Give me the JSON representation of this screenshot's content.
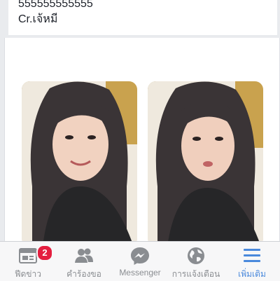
{
  "post": {
    "line1": "555555555555",
    "line2": "Cr.เจ้หมี"
  },
  "photos": [
    {
      "alt": "selfie smiling"
    },
    {
      "alt": "selfie pouting"
    }
  ],
  "tabbar": {
    "active_color": "#4a89dc",
    "inactive_color": "#8a8d91",
    "badge_color": "#e41e3f",
    "items": [
      {
        "label": "ฟีดข่าว",
        "icon": "news-feed-icon",
        "badge": "2"
      },
      {
        "label": "คำร้องขอ",
        "icon": "friend-requests-icon"
      },
      {
        "label": "Messenger",
        "icon": "messenger-icon"
      },
      {
        "label": "การแจ้งเตือน",
        "icon": "globe-notifications-icon"
      },
      {
        "label": "เพิ่มเติม",
        "icon": "menu-icon",
        "active": true
      }
    ]
  }
}
